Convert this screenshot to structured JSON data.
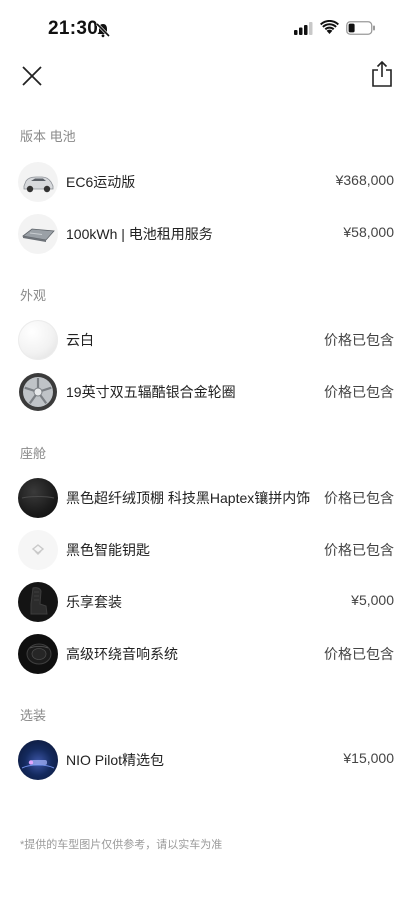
{
  "status": {
    "time": "21:30"
  },
  "sections": [
    {
      "title": "版本 电池",
      "items": [
        {
          "label": "EC6运动版",
          "price": "¥368,000",
          "thumb": "car-icon"
        },
        {
          "label": "100kWh | 电池租用服务",
          "price": "¥58,000",
          "thumb": "battery-pack-icon"
        }
      ]
    },
    {
      "title": "外观",
      "items": [
        {
          "label": "云白",
          "price": "价格已包含",
          "thumb": "white-swatch"
        },
        {
          "label": "19英寸双五辐酷银合金轮圈",
          "price": "价格已包含",
          "thumb": "wheel-icon"
        }
      ]
    },
    {
      "title": "座舱",
      "items": [
        {
          "label": "黑色超纤绒顶棚 科技黑Haptex镶拼内饰",
          "price": "价格已包含",
          "thumb": "black-fabric-swatch"
        },
        {
          "label": "黑色智能钥匙",
          "price": "价格已包含",
          "thumb": "key-icon"
        },
        {
          "label": "乐享套装",
          "price": "¥5,000",
          "thumb": "seat-icon"
        },
        {
          "label": "高级环绕音响系统",
          "price": "价格已包含",
          "thumb": "speaker-icon"
        }
      ]
    },
    {
      "title": "选装",
      "items": [
        {
          "label": "NIO Pilot精选包",
          "price": "¥15,000",
          "thumb": "pilot-icon"
        }
      ]
    }
  ],
  "footnote": "*提供的车型图片仅供参考，请以实车为准"
}
